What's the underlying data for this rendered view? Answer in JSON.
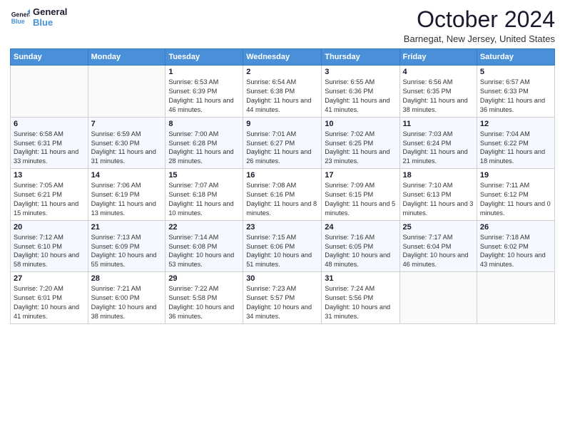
{
  "header": {
    "logo_line1": "General",
    "logo_line2": "Blue",
    "month": "October 2024",
    "location": "Barnegat, New Jersey, United States"
  },
  "days_of_week": [
    "Sunday",
    "Monday",
    "Tuesday",
    "Wednesday",
    "Thursday",
    "Friday",
    "Saturday"
  ],
  "weeks": [
    [
      {
        "day": "",
        "info": ""
      },
      {
        "day": "",
        "info": ""
      },
      {
        "day": "1",
        "info": "Sunrise: 6:53 AM\nSunset: 6:39 PM\nDaylight: 11 hours and 46 minutes."
      },
      {
        "day": "2",
        "info": "Sunrise: 6:54 AM\nSunset: 6:38 PM\nDaylight: 11 hours and 44 minutes."
      },
      {
        "day": "3",
        "info": "Sunrise: 6:55 AM\nSunset: 6:36 PM\nDaylight: 11 hours and 41 minutes."
      },
      {
        "day": "4",
        "info": "Sunrise: 6:56 AM\nSunset: 6:35 PM\nDaylight: 11 hours and 38 minutes."
      },
      {
        "day": "5",
        "info": "Sunrise: 6:57 AM\nSunset: 6:33 PM\nDaylight: 11 hours and 36 minutes."
      }
    ],
    [
      {
        "day": "6",
        "info": "Sunrise: 6:58 AM\nSunset: 6:31 PM\nDaylight: 11 hours and 33 minutes."
      },
      {
        "day": "7",
        "info": "Sunrise: 6:59 AM\nSunset: 6:30 PM\nDaylight: 11 hours and 31 minutes."
      },
      {
        "day": "8",
        "info": "Sunrise: 7:00 AM\nSunset: 6:28 PM\nDaylight: 11 hours and 28 minutes."
      },
      {
        "day": "9",
        "info": "Sunrise: 7:01 AM\nSunset: 6:27 PM\nDaylight: 11 hours and 26 minutes."
      },
      {
        "day": "10",
        "info": "Sunrise: 7:02 AM\nSunset: 6:25 PM\nDaylight: 11 hours and 23 minutes."
      },
      {
        "day": "11",
        "info": "Sunrise: 7:03 AM\nSunset: 6:24 PM\nDaylight: 11 hours and 21 minutes."
      },
      {
        "day": "12",
        "info": "Sunrise: 7:04 AM\nSunset: 6:22 PM\nDaylight: 11 hours and 18 minutes."
      }
    ],
    [
      {
        "day": "13",
        "info": "Sunrise: 7:05 AM\nSunset: 6:21 PM\nDaylight: 11 hours and 15 minutes."
      },
      {
        "day": "14",
        "info": "Sunrise: 7:06 AM\nSunset: 6:19 PM\nDaylight: 11 hours and 13 minutes."
      },
      {
        "day": "15",
        "info": "Sunrise: 7:07 AM\nSunset: 6:18 PM\nDaylight: 11 hours and 10 minutes."
      },
      {
        "day": "16",
        "info": "Sunrise: 7:08 AM\nSunset: 6:16 PM\nDaylight: 11 hours and 8 minutes."
      },
      {
        "day": "17",
        "info": "Sunrise: 7:09 AM\nSunset: 6:15 PM\nDaylight: 11 hours and 5 minutes."
      },
      {
        "day": "18",
        "info": "Sunrise: 7:10 AM\nSunset: 6:13 PM\nDaylight: 11 hours and 3 minutes."
      },
      {
        "day": "19",
        "info": "Sunrise: 7:11 AM\nSunset: 6:12 PM\nDaylight: 11 hours and 0 minutes."
      }
    ],
    [
      {
        "day": "20",
        "info": "Sunrise: 7:12 AM\nSunset: 6:10 PM\nDaylight: 10 hours and 58 minutes."
      },
      {
        "day": "21",
        "info": "Sunrise: 7:13 AM\nSunset: 6:09 PM\nDaylight: 10 hours and 55 minutes."
      },
      {
        "day": "22",
        "info": "Sunrise: 7:14 AM\nSunset: 6:08 PM\nDaylight: 10 hours and 53 minutes."
      },
      {
        "day": "23",
        "info": "Sunrise: 7:15 AM\nSunset: 6:06 PM\nDaylight: 10 hours and 51 minutes."
      },
      {
        "day": "24",
        "info": "Sunrise: 7:16 AM\nSunset: 6:05 PM\nDaylight: 10 hours and 48 minutes."
      },
      {
        "day": "25",
        "info": "Sunrise: 7:17 AM\nSunset: 6:04 PM\nDaylight: 10 hours and 46 minutes."
      },
      {
        "day": "26",
        "info": "Sunrise: 7:18 AM\nSunset: 6:02 PM\nDaylight: 10 hours and 43 minutes."
      }
    ],
    [
      {
        "day": "27",
        "info": "Sunrise: 7:20 AM\nSunset: 6:01 PM\nDaylight: 10 hours and 41 minutes."
      },
      {
        "day": "28",
        "info": "Sunrise: 7:21 AM\nSunset: 6:00 PM\nDaylight: 10 hours and 38 minutes."
      },
      {
        "day": "29",
        "info": "Sunrise: 7:22 AM\nSunset: 5:58 PM\nDaylight: 10 hours and 36 minutes."
      },
      {
        "day": "30",
        "info": "Sunrise: 7:23 AM\nSunset: 5:57 PM\nDaylight: 10 hours and 34 minutes."
      },
      {
        "day": "31",
        "info": "Sunrise: 7:24 AM\nSunset: 5:56 PM\nDaylight: 10 hours and 31 minutes."
      },
      {
        "day": "",
        "info": ""
      },
      {
        "day": "",
        "info": ""
      }
    ]
  ]
}
